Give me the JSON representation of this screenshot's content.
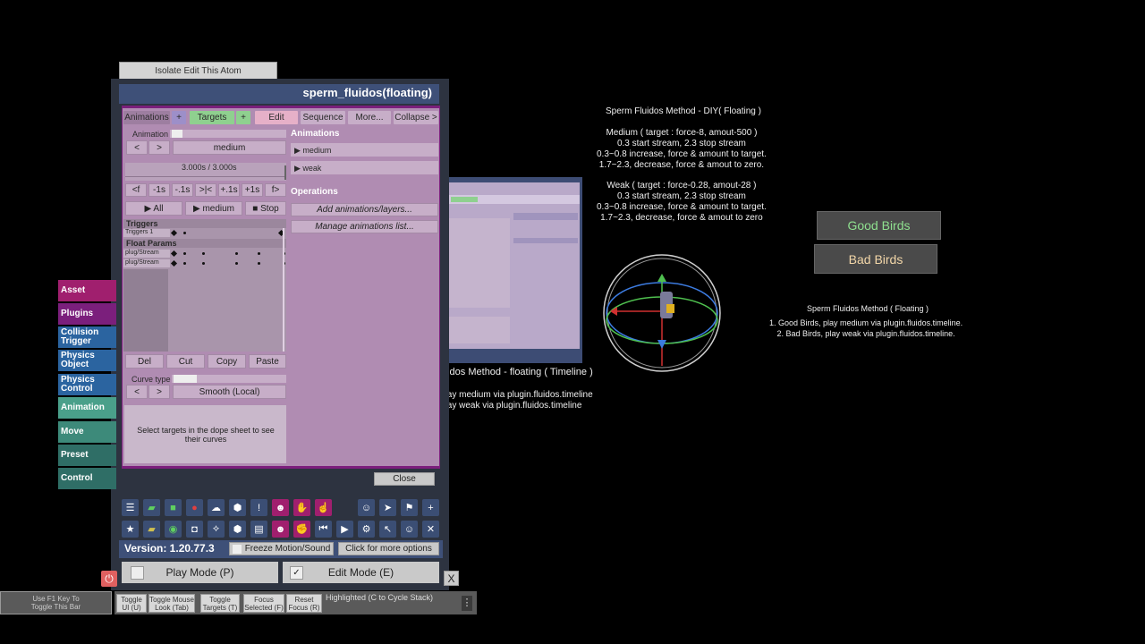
{
  "window": {
    "isolate_label": "Isolate Edit This Atom",
    "title": "sperm_fluidos(floating)"
  },
  "tabs": {
    "animations": "Animations",
    "plus1": "+",
    "targets": "Targets",
    "plus2": "+",
    "edit": "Edit",
    "sequence": "Sequence",
    "more": "More...",
    "collapse": "Collapse >"
  },
  "anim": {
    "label": "Animation",
    "prev": "<",
    "next": ">",
    "selected": "medium",
    "time": "3.000s / 3.000s",
    "seek": [
      "<f",
      "-1s",
      "-.1s",
      ">|<",
      "+.1s",
      "+1s",
      "f>"
    ],
    "play_all": "▶ All",
    "play_current": "▶ medium",
    "stop": "■ Stop"
  },
  "dope": {
    "triggers_header": "Triggers",
    "trigger_row": "Triggers 1",
    "float_header": "Float Params",
    "float_rows": [
      "plug/Stream",
      "plug/Stream"
    ]
  },
  "edit_buttons": [
    "Del",
    "Cut",
    "Copy",
    "Paste"
  ],
  "curve": {
    "label": "Curve type",
    "prev": "<",
    "next": ">",
    "value": "Smooth (Local)"
  },
  "hint": "Select targets in the dope sheet to see their curves",
  "animations_panel": {
    "header": "Animations",
    "items": [
      "▶ medium",
      "▶ weak"
    ],
    "ops_header": "Operations",
    "add_label": "Add animations/layers...",
    "manage_label": "Manage animations list..."
  },
  "close_label": "Close",
  "sidebar": [
    "Asset",
    "Plugins",
    "Collision Trigger",
    "Physics Object",
    "Physics Control",
    "Animation",
    "Move",
    "Preset",
    "Control"
  ],
  "version": "Version: 1.20.77.3",
  "freeze_label": "Freeze Motion/Sound",
  "more_options": "Click for more options",
  "play_mode": "Play Mode (P)",
  "edit_mode": "Edit Mode (E)",
  "close_x": "X",
  "footer": {
    "f1_hint": "Use F1 Key To Toggle This Bar",
    "buttons": [
      "Toggle UI (U)",
      "Toggle Mouse Look (Tab)",
      "Toggle Targets (T)",
      "Focus Selected (F)",
      "Reset Focus (R)"
    ],
    "highlighted": "Highlighted (C to Cycle Stack)"
  },
  "scene": {
    "diy_title": "Sperm Fluidos Method - DIY( Floating )",
    "diy_medium": "Medium ( target : force-8, amout-500 )\n0.3 start stream, 2.3 stop stream\n0.3~0.8 increase, force & amount to target.\n1.7~2.3, decrease, force & amout to zero.",
    "diy_weak": "Weak ( target : force-0.28, amout-28 )\n0.3 start stream, 2.3 stop stream\n0.3~0.8 increase, force & amount to target.\n1.7~2.3, decrease, force & amout to zero",
    "floating_title": "Sperm Fluidos Method ( Floating )",
    "floating_body": "1. Good Birds, play medium via plugin.fluidos.timeline.\n2. Bad Birds, play weak via plugin.fluidos.timeline.",
    "timeline_title": "uidos Method - floating ( Timeline )",
    "timeline_body": "play medium via plugin.fluidos.timeline\nplay weak via plugin.fluidos.timeline",
    "good_birds": "Good Birds",
    "bad_birds": "Bad Birds"
  },
  "colors": {
    "good_birds": "#8fe08f",
    "bad_birds": "#f2d6a8",
    "plugin_border": "#7b1f7c",
    "panel_bg": "#b08cb2"
  }
}
